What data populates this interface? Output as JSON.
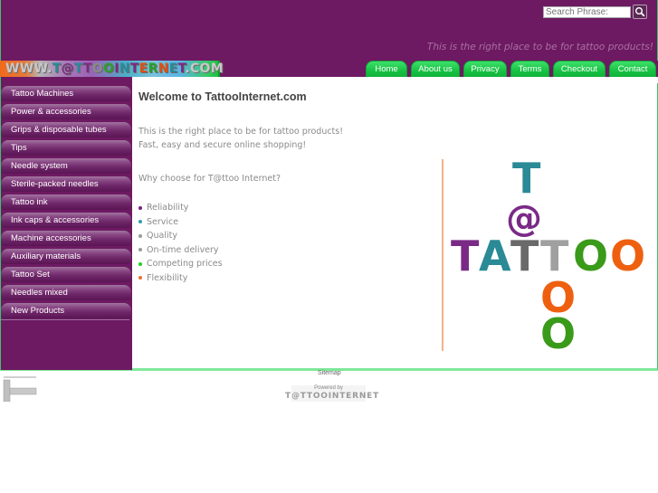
{
  "header": {
    "search": {
      "placeholder": "Search Phrase:",
      "button_icon": "magnifier-icon"
    },
    "tagline": "This is the right place to be for tattoo products!"
  },
  "logo": {
    "text": "WWW.T@TTOOINTERNET.COM"
  },
  "nav": {
    "tabs": [
      {
        "label": "Home"
      },
      {
        "label": "About us"
      },
      {
        "label": "Privacy"
      },
      {
        "label": "Terms"
      },
      {
        "label": "Checkout"
      },
      {
        "label": "Contact"
      }
    ]
  },
  "sidebar": {
    "items": [
      {
        "label": "Tattoo Machines"
      },
      {
        "label": "Power & accessories"
      },
      {
        "label": "Grips & disposable tubes"
      },
      {
        "label": "Tips"
      },
      {
        "label": "Needle system"
      },
      {
        "label": "Sterile-packed needles"
      },
      {
        "label": "Tattoo ink"
      },
      {
        "label": "Ink caps & accessories"
      },
      {
        "label": "Machine accessories"
      },
      {
        "label": "Auxiliary materials"
      },
      {
        "label": "Tattoo Set"
      },
      {
        "label": "Needles mixed"
      },
      {
        "label": "New Products"
      }
    ]
  },
  "main": {
    "title": "Welcome to TattooInternet.com",
    "intro_line1": "This is the right place to be for tattoo products!",
    "intro_line2": "Fast, easy and secure online shopping!",
    "why": "Why choose for T@ttoo Internet?",
    "features": [
      {
        "label": "Reliability",
        "color": "#7a1a86"
      },
      {
        "label": "Service",
        "color": "#2aa0a8"
      },
      {
        "label": "Quality",
        "color": "#9a9a9a"
      },
      {
        "label": "On-time delivery",
        "color": "#9a9a9a"
      },
      {
        "label": "Competing prices",
        "color": "#22cc22"
      },
      {
        "label": "Flexibility",
        "color": "#f07030"
      }
    ],
    "logo_image": {
      "letters": [
        "T",
        "@",
        "T",
        "A",
        "T",
        "T",
        "O",
        "O",
        "O",
        "O"
      ],
      "colors": {
        "purple": "#7a2a86",
        "teal": "#2a8a96",
        "dark_gray": "#6a6a6a",
        "light_gray": "#a0a0a0",
        "green": "#3a9a1a",
        "orange": "#ee6010"
      }
    }
  },
  "footer": {
    "sitemap": "Sitemap",
    "powered_by": "Powered by",
    "powered_logo": "T@TTOOINTERNET"
  },
  "colors": {
    "brand_purple": "#6d1a62",
    "nav_green": "#18c244",
    "border_green": "#3cc46a"
  }
}
